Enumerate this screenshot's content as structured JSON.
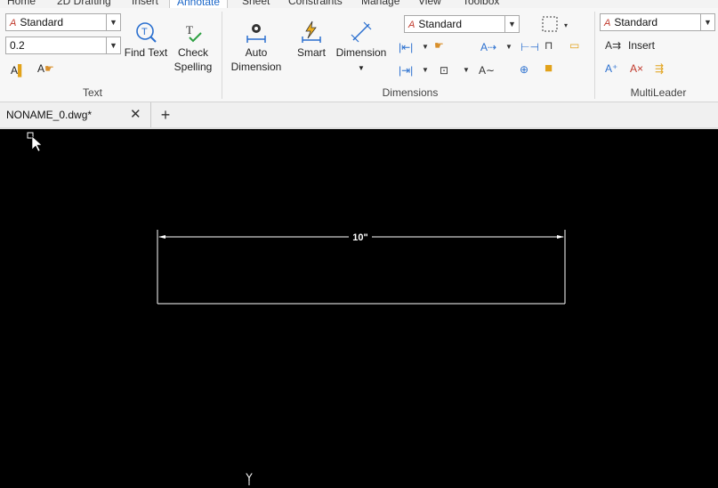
{
  "ribbon_tabs": [
    "Home",
    "2D Drafting",
    "Insert",
    "Annotate",
    "Sheet",
    "Constraints",
    "Manage",
    "View",
    "Toolbox"
  ],
  "active_tab": "Annotate",
  "text_group": {
    "label": "Text",
    "style_combo": "Standard",
    "height_combo": "0.2",
    "find_text": "Find Text",
    "check_spelling_l1": "Check",
    "check_spelling_l2": "Spelling"
  },
  "dimensions_group": {
    "label": "Dimensions",
    "auto_dim_l1": "Auto",
    "auto_dim_l2": "Dimension",
    "smart": "Smart",
    "dimension": "Dimension",
    "style_combo": "Standard"
  },
  "multileader_group": {
    "label": "MultiLeader",
    "style_combo": "Standard",
    "insert": "Insert"
  },
  "document_tab": "NONAME_0.dwg*",
  "drawing": {
    "dimension_text": "10\"",
    "axis_label": "Y"
  },
  "colors": {
    "canvas": "#000000",
    "accent": "#2a6fcf"
  }
}
